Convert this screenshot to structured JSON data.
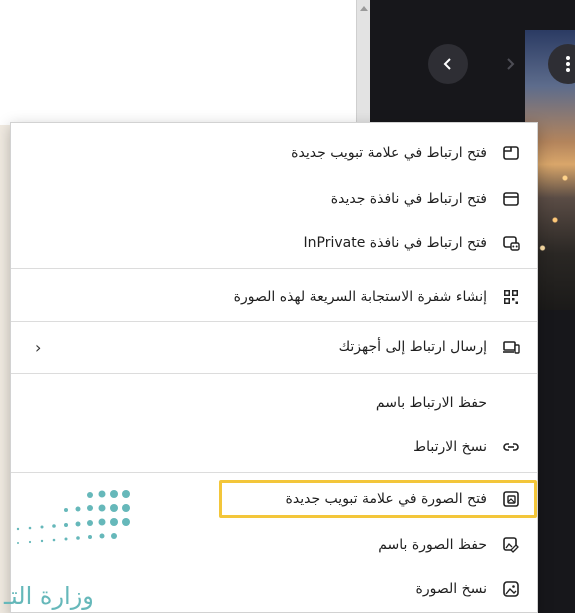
{
  "background": {
    "nav_prev_icon": "chevron-left-icon",
    "nav_next_icon": "chevron-right-icon",
    "more_icon": "more-vertical-icon"
  },
  "menu": {
    "items": [
      {
        "label": "فتح ارتباط في علامة تبويب جديدة",
        "icon": "new-tab-icon"
      },
      {
        "label": "فتح ارتباط في نافذة جديدة",
        "icon": "new-window-icon"
      },
      {
        "label": "فتح ارتباط في نافذة InPrivate",
        "icon": "inprivate-window-icon"
      },
      {
        "label": "إنشاء شفرة الاستجابة السريعة لهذه الصورة",
        "icon": "qr-code-icon"
      },
      {
        "label": "إرسال ارتباط إلى أجهزتك",
        "icon": "send-to-devices-icon"
      },
      {
        "label": "حفظ الارتباط باسم",
        "icon": ""
      },
      {
        "label": "نسخ الارتباط",
        "icon": "link-icon"
      },
      {
        "label": "فتح الصورة في علامة تبويب جديدة",
        "icon": "open-image-icon"
      },
      {
        "label": "حفظ الصورة باسم",
        "icon": "save-image-icon"
      },
      {
        "label": "نسخ الصورة",
        "icon": "copy-image-icon"
      }
    ],
    "submenu_chevron": "‹"
  },
  "watermark": {
    "text": "وزارة التـ"
  },
  "colors": {
    "highlight": "#f3c63a",
    "watermark": "#66b8ba"
  }
}
